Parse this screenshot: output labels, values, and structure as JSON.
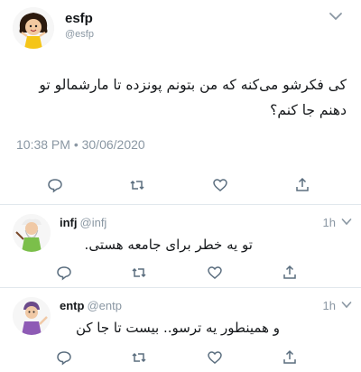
{
  "main_tweet": {
    "name": "esfp",
    "handle": "@esfp",
    "text": "کی فکرشو می‌کنه که من بتونم پونزده تا مارشمالو تو دهنم جا کنم؟",
    "timestamp": "10:38 PM • 30/06/2020",
    "actions": [
      "reply-icon",
      "retweet-icon",
      "like-icon",
      "share-icon"
    ]
  },
  "replies": [
    {
      "name": "infj",
      "handle": "@infj",
      "time": "1h",
      "text": "تو یه خطر برای جامعه هستی."
    },
    {
      "name": "entp",
      "handle": "@entp",
      "time": "1h",
      "text": "و همینطور یه ترسو.. بیست تا جا کن"
    }
  ],
  "colors": {
    "text": "#14171a",
    "muted": "#8a97a3",
    "divider": "#e1e8ed"
  }
}
